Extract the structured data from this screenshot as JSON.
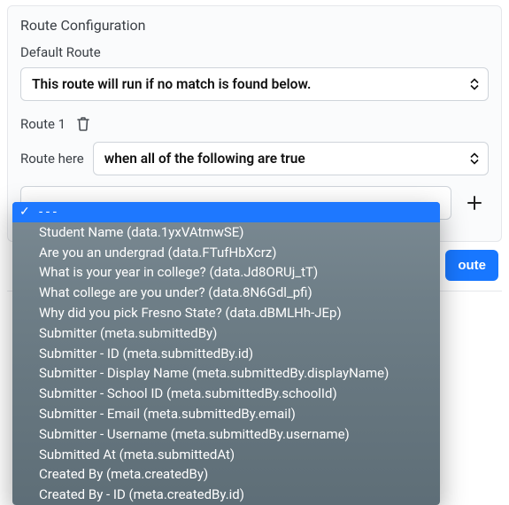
{
  "panel": {
    "title": "Route Configuration",
    "default_label": "Default Route",
    "default_select_text": "This route will run if no match is found below.",
    "route1_label": "Route 1",
    "route_here_label": "Route here",
    "route_here_select_text": "when all of the following are true",
    "add_route_label": "oute"
  },
  "dropdown": {
    "items": [
      "- - -",
      "Student Name (data.1yxVAtmwSE)",
      "Are you an undergrad (data.FTufHbXcrz)",
      "What is your year in college? (data.Jd8ORUj_tT)",
      "What college are you under? (data.8N6Gdl_pfi)",
      "Why did you pick Fresno State? (data.dBMLHh-JEp)",
      "Submitter (meta.submittedBy)",
      "Submitter - ID (meta.submittedBy.id)",
      "Submitter - Display Name (meta.submittedBy.displayName)",
      "Submitter - School ID (meta.submittedBy.schoolId)",
      "Submitter - Email (meta.submittedBy.email)",
      "Submitter - Username (meta.submittedBy.username)",
      "Submitted At (meta.submittedAt)",
      "Created By (meta.createdBy)",
      "Created By - ID (meta.createdBy.id)"
    ],
    "selected_index": 0
  }
}
